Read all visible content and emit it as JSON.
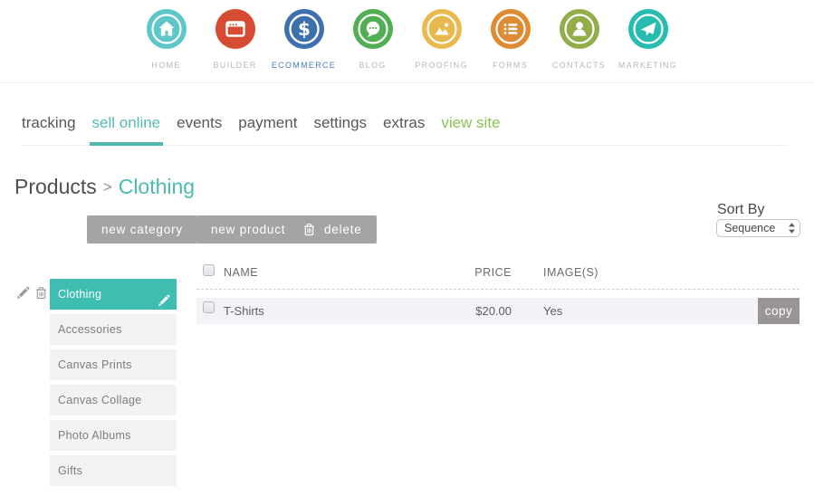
{
  "nav": {
    "items": [
      {
        "label": "HOME",
        "icon": "home-icon",
        "color": "#5cc6c9",
        "active": false
      },
      {
        "label": "BUILDER",
        "icon": "builder-icon",
        "color": "#d74b32",
        "active": false
      },
      {
        "label": "ECOMMERCE",
        "icon": "ecommerce-icon",
        "color": "#3d71ad",
        "active": true
      },
      {
        "label": "BLOG",
        "icon": "blog-icon",
        "color": "#52ae53",
        "active": false
      },
      {
        "label": "PROOFING",
        "icon": "proofing-icon",
        "color": "#eab94d",
        "active": false
      },
      {
        "label": "FORMS",
        "icon": "forms-icon",
        "color": "#de8c33",
        "active": false
      },
      {
        "label": "CONTACTS",
        "icon": "contacts-icon",
        "color": "#93ad4b",
        "active": false
      },
      {
        "label": "MARKETING",
        "icon": "marketing-icon",
        "color": "#26bdb0",
        "active": false
      }
    ],
    "active_label_color": "#4a7cb8"
  },
  "tabs": {
    "items": [
      {
        "label": "tracking"
      },
      {
        "label": "sell online"
      },
      {
        "label": "events"
      },
      {
        "label": "payment"
      },
      {
        "label": "settings"
      },
      {
        "label": "extras"
      },
      {
        "label": "view site"
      }
    ],
    "active": "sell online"
  },
  "breadcrumb": {
    "parent": "Products",
    "separator": ">",
    "current": "Clothing"
  },
  "toolbar": {
    "new_category": "new category",
    "new_product": "new product",
    "delete": "delete"
  },
  "sort": {
    "label": "Sort By",
    "value": "Sequence"
  },
  "categories": {
    "items": [
      "Clothing",
      "Accessories",
      "Canvas Prints",
      "Canvas Collage",
      "Photo Albums",
      "Gifts"
    ],
    "selected": "Clothing"
  },
  "table": {
    "headers": {
      "name": "NAME",
      "price": "PRICE",
      "images": "IMAGE(S)"
    },
    "rows": [
      {
        "name": "T-Shirts",
        "price": "$20.00",
        "images": "Yes",
        "action": "copy"
      }
    ]
  },
  "colors": {
    "accent_teal": "#4cbcb2",
    "tab_underline": "#4cb9ac",
    "category_selected_bg": "#3fbdb1",
    "view_site_green": "#8dc153",
    "button_gray": "#a6a3a3",
    "copy_button_gray": "#999597",
    "row_bg": "#f3f2f6",
    "category_bg": "#f2f1f4",
    "active_nav_label_blue": "#4a7cb8"
  }
}
